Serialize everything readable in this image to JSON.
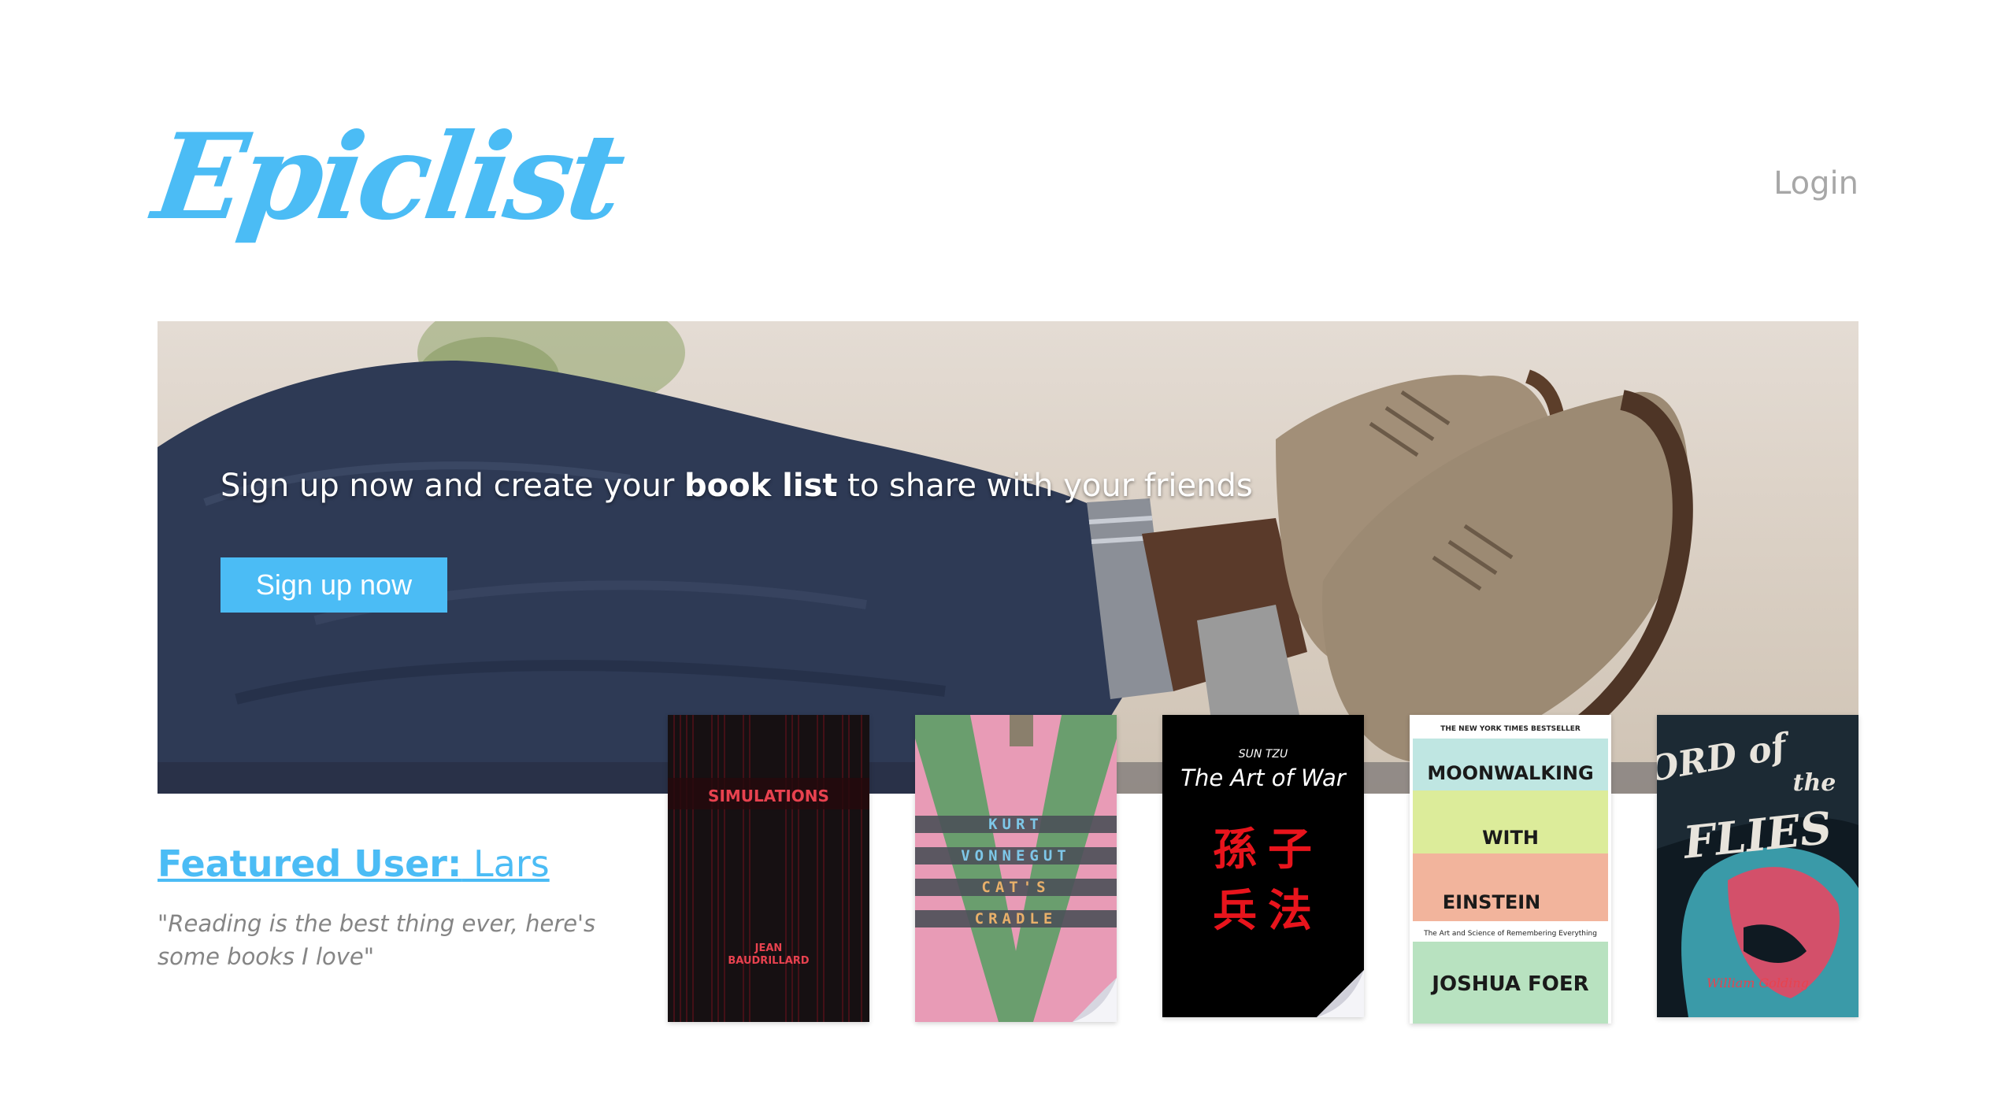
{
  "brand": {
    "logo": "Epiclist",
    "accent": "#4bbcf5"
  },
  "nav": {
    "login_label": "Login"
  },
  "hero": {
    "text_before": "Sign up now and create your ",
    "text_bold": "book list",
    "text_after": " to share with your friends",
    "signup_label": "Sign up now"
  },
  "featured": {
    "label": "Featured User:",
    "name": "Lars",
    "quote": "\"Reading is the best thing ever, here's some books I love\""
  },
  "books": [
    {
      "title": "SIMULATIONS",
      "author_line1": "JEAN",
      "author_line2": "BAUDRILLARD"
    },
    {
      "author_line1": "KURT",
      "author_line2": "VONNEGUT",
      "title_line1": "CAT'S",
      "title_line2": "CRADLE"
    },
    {
      "author": "SUN TZU",
      "title": "The Art of War",
      "chars": [
        "孫",
        "子",
        "兵",
        "法"
      ]
    },
    {
      "banner": "THE NEW YORK TIMES BESTSELLER",
      "title_line1": "MOONWALKING",
      "title_line2": "WITH",
      "title_line3": "EINSTEIN",
      "subtitle": "The Art and Science of Remembering Everything",
      "author": "JOSHUA FOER"
    },
    {
      "title_line1": "LORD of",
      "title_line2": "the",
      "title_line3": "FLIES",
      "author": "William Golding"
    }
  ]
}
